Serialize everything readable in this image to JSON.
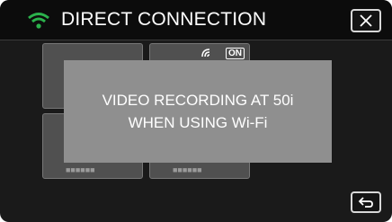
{
  "header": {
    "title": "DIRECT CONNECTION",
    "wifi_icon": "wifi-icon",
    "close_icon": "close-icon"
  },
  "tiles": [
    {
      "id": "tile-1",
      "icon": "play-icon",
      "dots": ""
    },
    {
      "id": "tile-2",
      "icon": "cast-icon",
      "badge": "ON",
      "dots": ""
    },
    {
      "id": "tile-3",
      "icon": "",
      "dots": "■■■■■■"
    },
    {
      "id": "tile-4",
      "icon": "",
      "dots": "■■■■■■"
    }
  ],
  "dialog": {
    "line1": "VIDEO RECORDING AT 50i",
    "line2": "WHEN USING Wi-Fi"
  },
  "footer": {
    "back_icon": "return-icon"
  },
  "colors": {
    "wifi": "#2bb24c",
    "dialog_bg": "#8f8f8f",
    "play": "#1e6fd9"
  }
}
